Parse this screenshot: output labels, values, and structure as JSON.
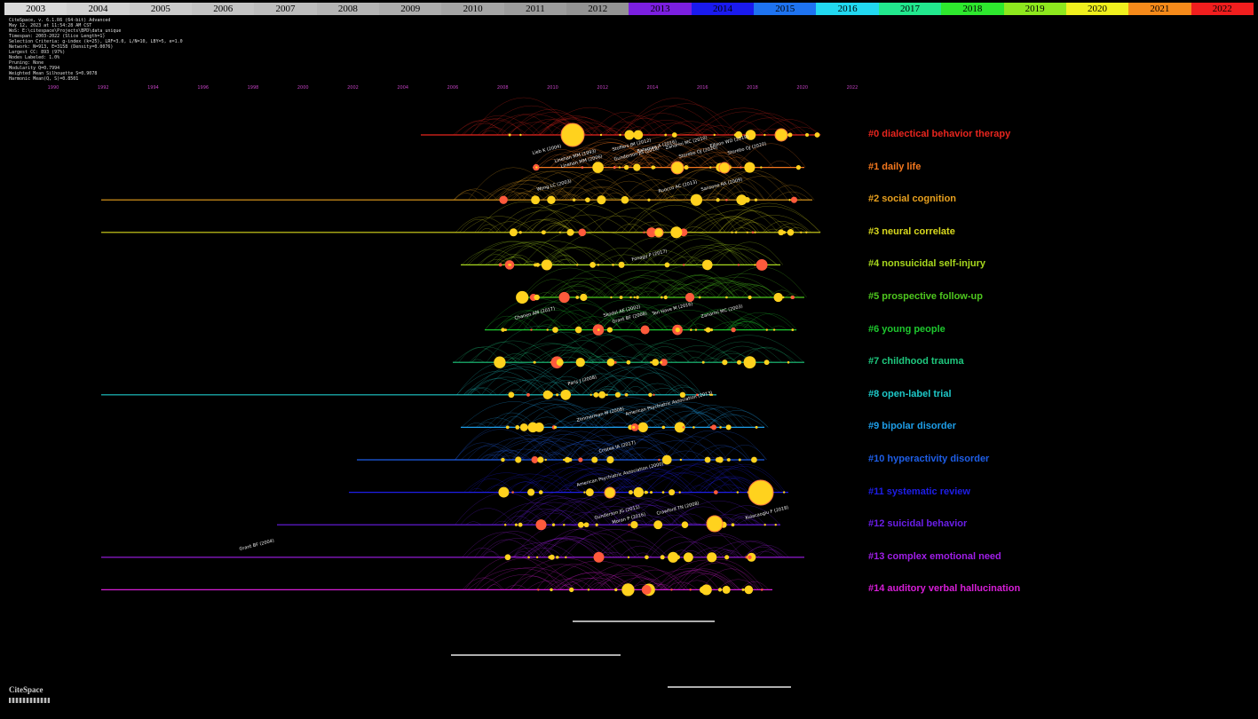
{
  "year_bar": [
    {
      "year": "2003",
      "color": "#d9d9d9"
    },
    {
      "year": "2004",
      "color": "#d2d2d2"
    },
    {
      "year": "2005",
      "color": "#cbcbcb"
    },
    {
      "year": "2006",
      "color": "#c4c4c4"
    },
    {
      "year": "2007",
      "color": "#bdbdbd"
    },
    {
      "year": "2008",
      "color": "#b5b5b5"
    },
    {
      "year": "2009",
      "color": "#adadad"
    },
    {
      "year": "2010",
      "color": "#a5a5a5"
    },
    {
      "year": "2011",
      "color": "#9c9c9c"
    },
    {
      "year": "2012",
      "color": "#939393"
    },
    {
      "year": "2013",
      "color": "#7b1fe0"
    },
    {
      "year": "2014",
      "color": "#1a1aee"
    },
    {
      "year": "2015",
      "color": "#1e73f0"
    },
    {
      "year": "2016",
      "color": "#22d8f0"
    },
    {
      "year": "2017",
      "color": "#22e88e"
    },
    {
      "year": "2018",
      "color": "#2ee82e"
    },
    {
      "year": "2019",
      "color": "#8ee81e"
    },
    {
      "year": "2020",
      "color": "#f0f01e"
    },
    {
      "year": "2021",
      "color": "#f58a1a"
    },
    {
      "year": "2022",
      "color": "#f01e1e"
    }
  ],
  "info_lines": [
    "CiteSpace, v. 6.1.R6 (64-bit) Advanced",
    "May 12, 2023 at 11:54:28 AM CST",
    "WoS: E:\\citespace\\Projects\\BPD\\data_unique",
    "Timespan: 2003-2022 (Slice Length=1)",
    "Selection Criteria: g-index (k=25), LRF=3.0, L/N=10, LBY=5, e=1.0",
    "Network: N=913, E=3158 (Density=0.0076)",
    "Largest CC: 893 (97%)",
    "Nodes Labeled: 1.0%",
    "Pruning: None",
    "Modularity Q=0.7994",
    "Weighted Mean Silhouette S=0.9078",
    "Harmonic Mean(Q, S)=0.8501"
  ],
  "logo": "CiteSpace",
  "chart_data": {
    "type": "scatter",
    "timeline_ticks": [
      "1990",
      "1992",
      "1994",
      "1996",
      "1998",
      "2000",
      "2002",
      "2004",
      "2006",
      "2008",
      "2010",
      "2012",
      "2014",
      "2016",
      "2018",
      "2020",
      "2022"
    ],
    "clusters": [
      {
        "id": 0,
        "label": "#0 dialectical behavior therapy",
        "color": "#e8251e",
        "start": 0.46,
        "end": 0.96
      },
      {
        "id": 1,
        "label": "#1 daily life",
        "color": "#f5781e",
        "start": 0.6,
        "end": 0.94
      },
      {
        "id": 2,
        "label": "#2 social cognition",
        "color": "#e8a01e",
        "start": 0.06,
        "end": 0.95
      },
      {
        "id": 3,
        "label": "#3 neural correlate",
        "color": "#d8d81e",
        "start": 0.06,
        "end": 0.96
      },
      {
        "id": 4,
        "label": "#4 nonsuicidal self-injury",
        "color": "#a8d81e",
        "start": 0.51,
        "end": 0.91
      },
      {
        "id": 5,
        "label": "#5 prospective follow-up",
        "color": "#4ec81e",
        "start": 0.58,
        "end": 0.94
      },
      {
        "id": 6,
        "label": "#6 young people",
        "color": "#1ec82e",
        "start": 0.54,
        "end": 0.93
      },
      {
        "id": 7,
        "label": "#7 childhood trauma",
        "color": "#1ec87e",
        "start": 0.5,
        "end": 0.94
      },
      {
        "id": 8,
        "label": "#8 open-label trial",
        "color": "#1ec8c8",
        "start": 0.06,
        "end": 0.83
      },
      {
        "id": 9,
        "label": "#9 bipolar disorder",
        "color": "#1e9ee8",
        "start": 0.51,
        "end": 0.89
      },
      {
        "id": 10,
        "label": "#10 hyperactivity disorder",
        "color": "#1e5ee8",
        "start": 0.38,
        "end": 0.89
      },
      {
        "id": 11,
        "label": "#11 systematic review",
        "color": "#1e1ee8",
        "start": 0.37,
        "end": 0.92
      },
      {
        "id": 12,
        "label": "#12 suicidal behavior",
        "color": "#6a1ee8",
        "start": 0.28,
        "end": 0.91
      },
      {
        "id": 13,
        "label": "#13 complex emotional need",
        "color": "#a01ee8",
        "start": 0.06,
        "end": 0.94
      },
      {
        "id": 14,
        "label": "#14 auditory verbal hallucination",
        "color": "#d81ed8",
        "start": 0.06,
        "end": 0.9
      }
    ],
    "annotations": [
      "Lieb K (2004)",
      "Linehan MM (1993)",
      "Linehan MM (2006)",
      "Stoffers JM (2012)",
      "Gunderson JG (2018)",
      "Bateman A (2016)",
      "Zanarini MC (2010)",
      "Storebo OJ (2020)",
      "Ellison WD (2018)",
      "Storebo OJ (2020)",
      "Wong LC (2003)",
      "Ruocco AC (2013)",
      "Sansone RA (2009)",
      "Fonagy P (2017)",
      "Chanen AM (2017)",
      "Skodol AE (2002)",
      "Grant BF (2008)",
      "Ten Have M (2016)",
      "Zanarini MC (2003)",
      "Paris J (2008)",
      "Zimmerman M (2008)",
      "American Psychiatric Association (2013)",
      "Cristea IA (2017)",
      "American Psychiatric Association (2000)",
      "Gunderson JG (2011)",
      "Moran P (2016)",
      "Crawford TN (2008)",
      "Kulacaoglu F (2018)",
      "Grant BF (2004)"
    ]
  }
}
